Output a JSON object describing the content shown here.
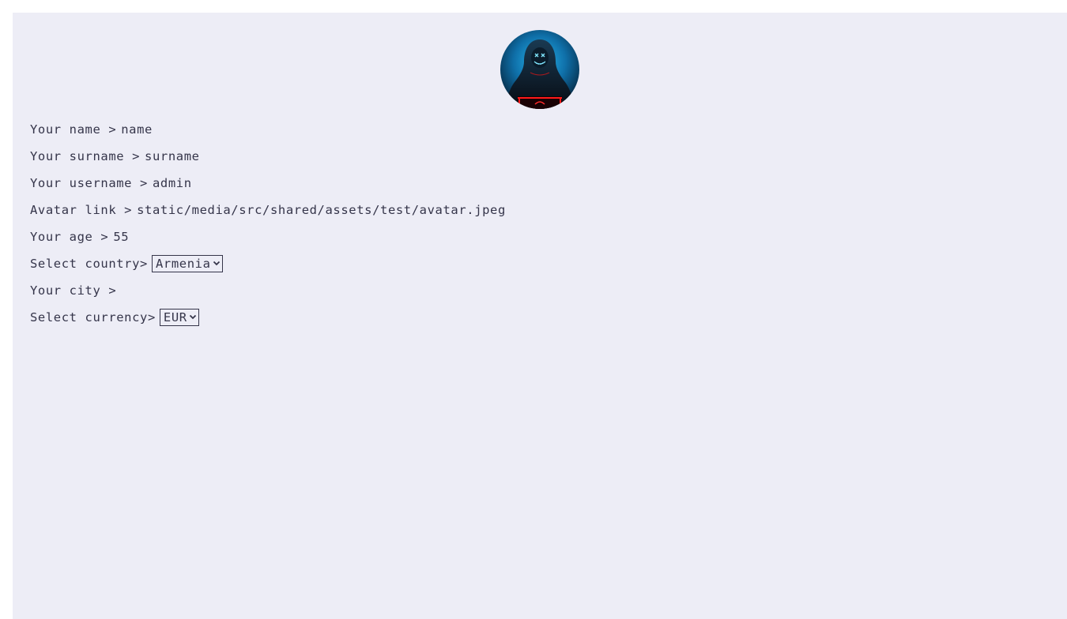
{
  "profile": {
    "avatar_icon": "hooded-figure-avatar",
    "fields": [
      {
        "label": "Your name >",
        "value": "name"
      },
      {
        "label": "Your surname >",
        "value": "surname"
      },
      {
        "label": "Your username >",
        "value": "admin"
      },
      {
        "label": "Avatar link >",
        "value": "static/media/src/shared/assets/test/avatar.jpeg"
      },
      {
        "label": "Your age >",
        "value": "55"
      }
    ],
    "country": {
      "label": "Select country>",
      "selected": "Armenia"
    },
    "city": {
      "label": "Your city >",
      "value": ""
    },
    "currency": {
      "label": "Select currency>",
      "selected": "EUR"
    }
  },
  "colors": {
    "panel_bg": "#ededf6",
    "text": "#35354a"
  }
}
